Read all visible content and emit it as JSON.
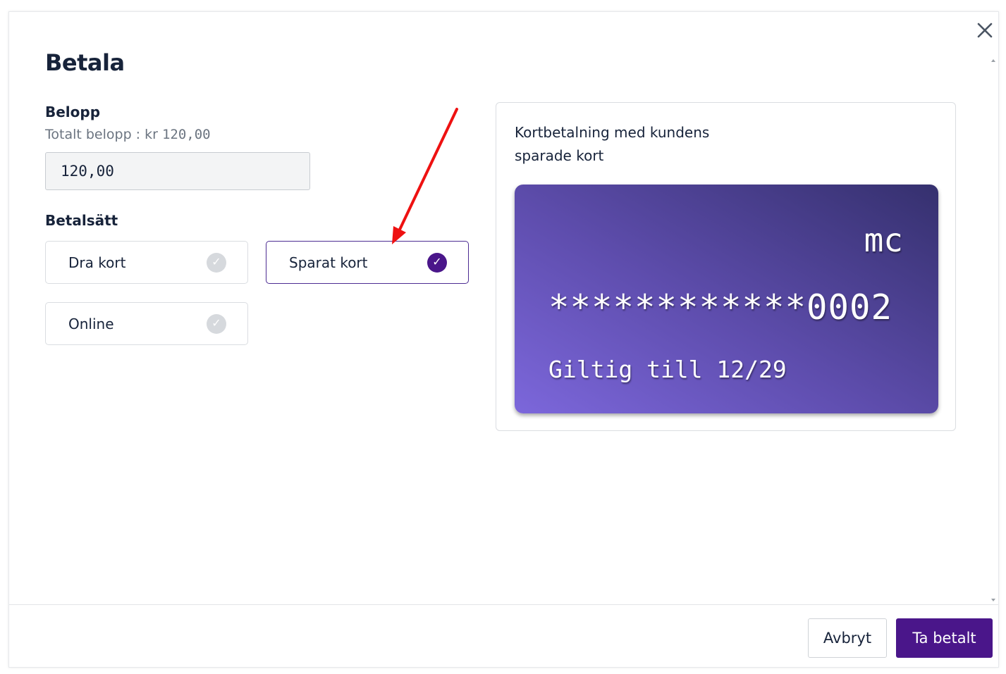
{
  "dialog": {
    "title": "Betala",
    "close_icon": "close-icon"
  },
  "amount": {
    "label": "Belopp",
    "total_prefix": "Totalt belopp : kr ",
    "total_value": "120,00",
    "input_value": "120,00"
  },
  "payment_method": {
    "label": "Betalsätt",
    "options": [
      {
        "label": "Dra kort",
        "selected": false
      },
      {
        "label": "Sparat kort",
        "selected": true
      },
      {
        "label": "Online",
        "selected": false
      }
    ],
    "check_glyph": "✓"
  },
  "info": {
    "text": "Kortbetalning med kundens sparade kort"
  },
  "card": {
    "brand": "mc",
    "number": "************0002",
    "expiry": "Giltig till 12/29"
  },
  "footer": {
    "cancel_label": "Avbryt",
    "pay_label": "Ta betalt"
  },
  "colors": {
    "accent": "#4a168a",
    "annotation_arrow": "#ee1111"
  }
}
